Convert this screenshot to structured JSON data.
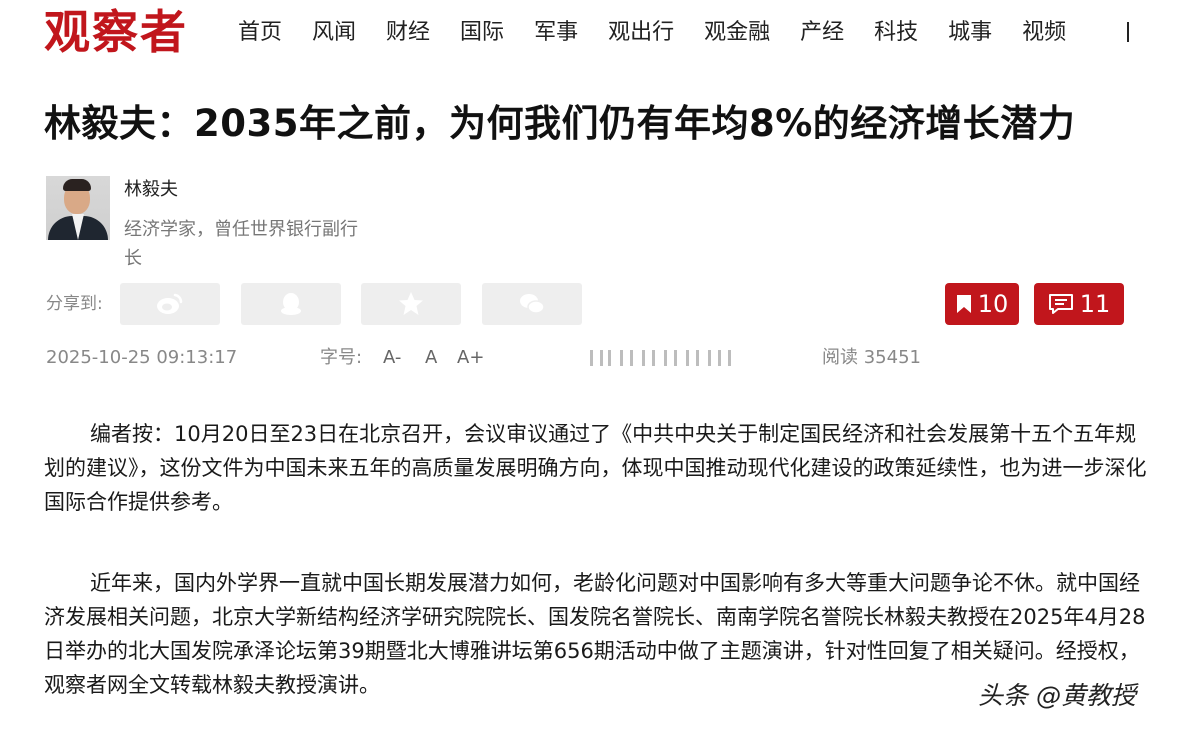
{
  "site": {
    "logo": "观察者"
  },
  "nav": [
    "首页",
    "风闻",
    "财经",
    "国际",
    "军事",
    "观出行",
    "观金融",
    "产经",
    "科技",
    "城事",
    "视频"
  ],
  "article": {
    "title": "林毅夫：2035年之前，为何我们仍有年均8%的经济增长潜力",
    "author_name": "林毅夫",
    "author_desc": "经济学家，曾任世界银行副行长",
    "share_label": "分享到:",
    "share_icons": [
      "weibo-icon",
      "qq-icon",
      "qzone-star-icon",
      "wechat-icon"
    ],
    "bookmark_count": "10",
    "comment_count": "11",
    "datetime": "2025-10-25 09:13:17",
    "font_label": "字号:",
    "font_small": "A-",
    "font_normal": "A",
    "font_large": "A+",
    "read_count": "阅读 35451",
    "paragraphs": [
      "编者按：10月20日至23日在北京召开，会议审议通过了《中共中央关于制定国民经济和社会发展第十五个五年规划的建议》，这份文件为中国未来五年的高质量发展明确方向，体现中国推动现代化建设的政策延续性，也为进一步深化国际合作提供参考。",
      "近年来，国内外学界一直就中国长期发展潜力如何，老龄化问题对中国影响有多大等重大问题争论不休。就中国经济发展相关问题，北京大学新结构经济学研究院院长、国发院名誉院长、南南学院名誉院长林毅夫教授在2025年4月28日举办的北大国发院承泽论坛第39期暨北大博雅讲坛第656期活动中做了主题演讲，针对性回复了相关疑问。经授权，观察者网全文转载林毅夫教授演讲。"
    ]
  },
  "watermark": "头条 @黄教授",
  "colors": {
    "brand": "#c1161c",
    "muted": "#888888",
    "share_bg": "#eeeeee"
  }
}
